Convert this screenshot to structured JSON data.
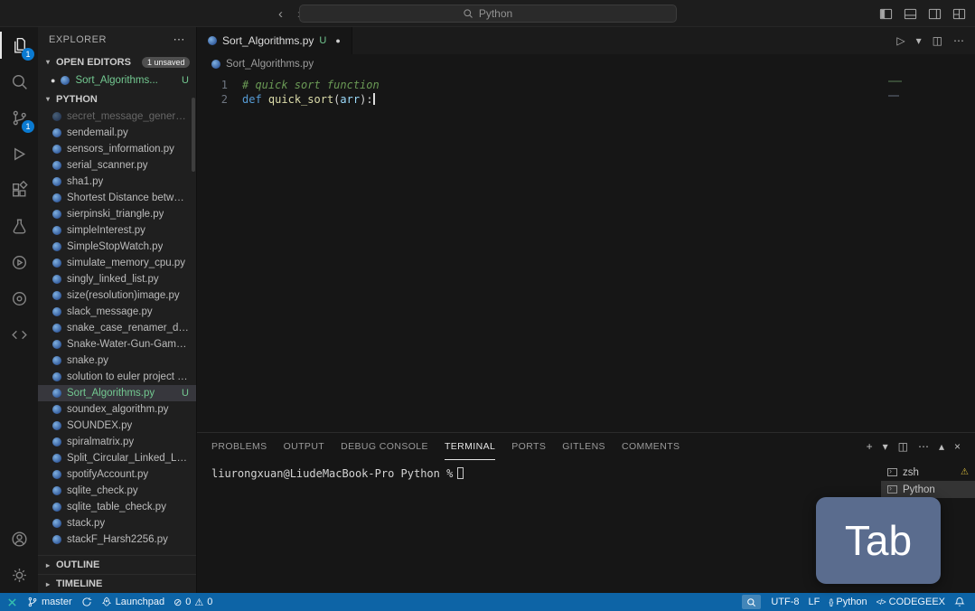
{
  "window": {
    "search_value": "Python"
  },
  "icons": {
    "back": "‹",
    "forward": "›",
    "ellipsis": "⋯",
    "chevron_down": "▾",
    "chevron_up": "▴",
    "chevron_right": "▸",
    "plus": "+",
    "close": "×",
    "split": "◫",
    "run": "▷",
    "dot": "●",
    "error": "⊘",
    "warning": "⚠",
    "braces": "{}",
    "code": "</>"
  },
  "activity_bar": {
    "explorer_badge": "1",
    "scm_badge": "1"
  },
  "sidebar": {
    "explorer_title": "EXPLORER",
    "open_editors": {
      "label": "OPEN EDITORS",
      "badge": "1 unsaved",
      "file": "Sort_Algorithms...",
      "status": "U"
    },
    "section_label": "PYTHON",
    "files": [
      {
        "name": "secret_message_generato...",
        "state": "dim"
      },
      {
        "name": "sendemail.py"
      },
      {
        "name": "sensors_information.py"
      },
      {
        "name": "serial_scanner.py"
      },
      {
        "name": "sha1.py"
      },
      {
        "name": "Shortest Distance betwee..."
      },
      {
        "name": "sierpinski_triangle.py"
      },
      {
        "name": "simpleInterest.py"
      },
      {
        "name": "SimpleStopWatch.py"
      },
      {
        "name": "simulate_memory_cpu.py"
      },
      {
        "name": "singly_linked_list.py"
      },
      {
        "name": "size(resolution)image.py"
      },
      {
        "name": "slack_message.py"
      },
      {
        "name": "snake_case_renamer_dec..."
      },
      {
        "name": "Snake-Water-Gun-Game.py"
      },
      {
        "name": "snake.py"
      },
      {
        "name": "solution to euler project pr..."
      },
      {
        "name": "Sort_Algorithms.py",
        "status": "U",
        "state": "selected"
      },
      {
        "name": "soundex_algorithm.py"
      },
      {
        "name": "SOUNDEX.py"
      },
      {
        "name": "spiralmatrix.py"
      },
      {
        "name": "Split_Circular_Linked_List..."
      },
      {
        "name": "spotifyAccount.py"
      },
      {
        "name": "sqlite_check.py"
      },
      {
        "name": "sqlite_table_check.py"
      },
      {
        "name": "stack.py"
      },
      {
        "name": "stackF_Harsh2256.py"
      }
    ],
    "outline_label": "OUTLINE",
    "timeline_label": "TIMELINE"
  },
  "editor": {
    "tab": {
      "name": "Sort_Algorithms.py",
      "status": "U"
    },
    "breadcrumb": "Sort_Algorithms.py",
    "lines": [
      {
        "n": "1",
        "tokens": [
          {
            "type": "comment",
            "text": "# quick sort function"
          }
        ]
      },
      {
        "n": "2",
        "cursor": true,
        "tokens": [
          {
            "type": "keyword",
            "text": "def"
          },
          {
            "type": "plain",
            "text": " "
          },
          {
            "type": "function",
            "text": "quick_sort"
          },
          {
            "type": "plain",
            "text": "("
          },
          {
            "type": "param",
            "text": "arr"
          },
          {
            "type": "plain",
            "text": "):"
          }
        ]
      }
    ]
  },
  "panel": {
    "tabs": [
      "PROBLEMS",
      "OUTPUT",
      "DEBUG CONSOLE",
      "TERMINAL",
      "PORTS",
      "GITLENS",
      "COMMENTS"
    ],
    "active_tab": "TERMINAL",
    "prompt": "liurongxuan@LiudeMacBook-Pro Python %",
    "terminals": [
      {
        "name": "zsh",
        "warning": true
      },
      {
        "name": "Python",
        "active": true
      }
    ]
  },
  "statusbar": {
    "branch": "master",
    "launchpad": "Launchpad",
    "errors": "0",
    "warnings": "0",
    "encoding": "UTF-8",
    "eol": "LF",
    "language": "Python",
    "codegeex": "CODEGEEX"
  },
  "overlay": {
    "key_label": "Tab"
  },
  "colors": {
    "statusbar_bg": "#0d64a6",
    "badge_bg": "#0a7ad1",
    "untracked": "#73c991",
    "warning": "#d7ba3c",
    "selection_bg": "#37373d",
    "keycast_bg": "#5a6c8e"
  }
}
